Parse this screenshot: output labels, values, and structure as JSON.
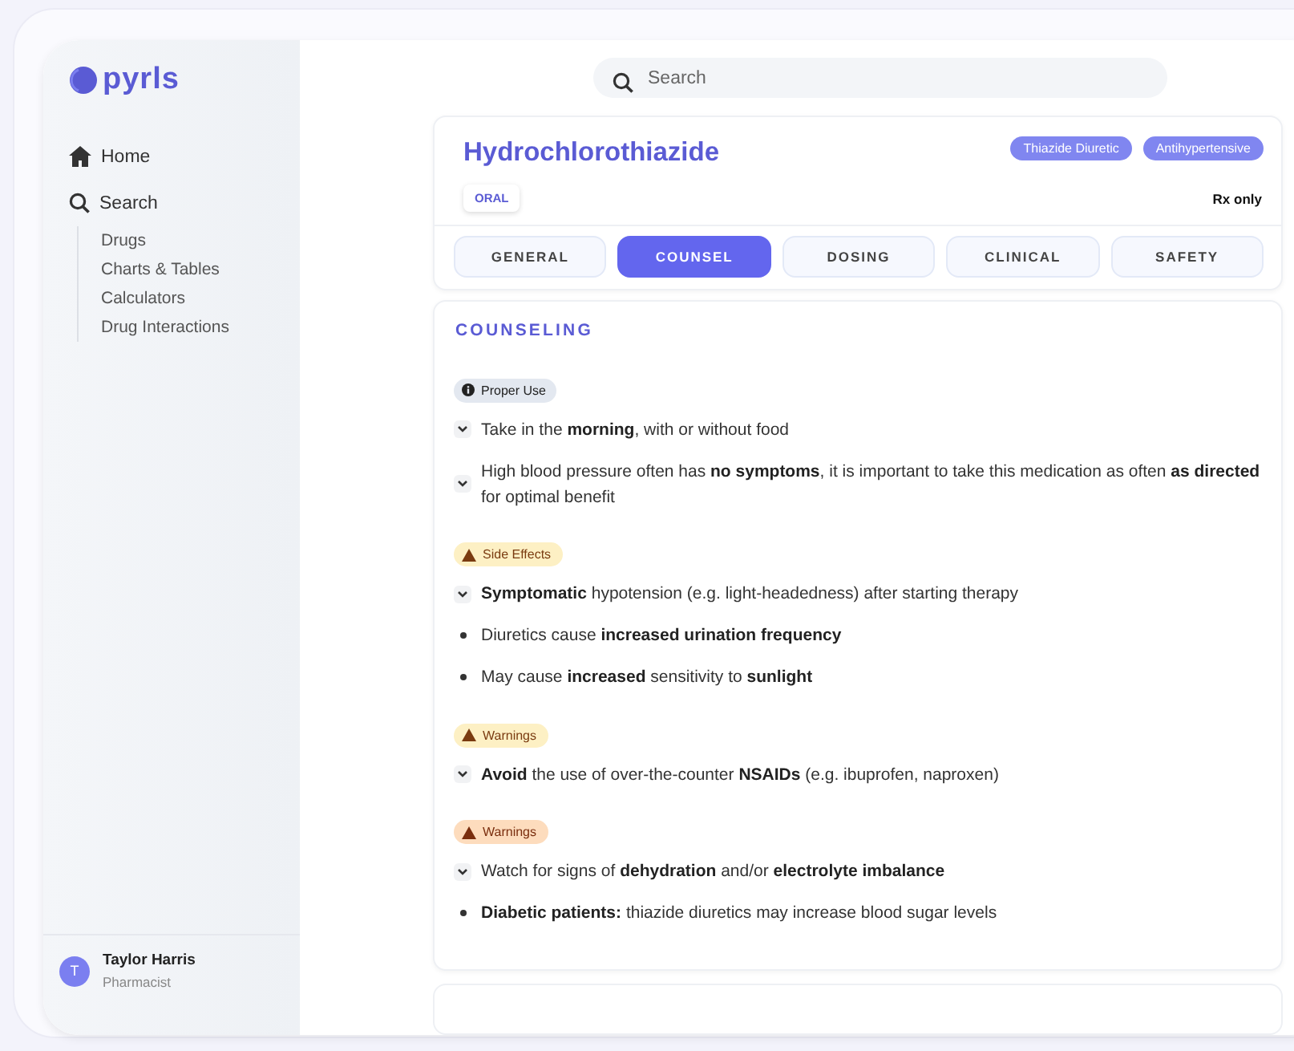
{
  "sidebar": {
    "logo": "pyrls",
    "nav": [
      {
        "label": "Home",
        "kind": "home"
      },
      {
        "label": "Search",
        "kind": "search",
        "children": [
          {
            "label": "Drugs"
          },
          {
            "label": "Charts & Tables"
          },
          {
            "label": "Calculators"
          },
          {
            "label": "Drug Interactions"
          }
        ]
      }
    ],
    "user": {
      "initial": "T",
      "name": "Taylor Harris",
      "role": "Pharmacist"
    }
  },
  "search": {
    "placeholder": "Search"
  },
  "drug": {
    "name": "Hydrochlorothiazide",
    "tags": [
      "Thiazide Diuretic",
      "Antihypertensive"
    ],
    "route": "ORAL",
    "status": "Rx only"
  },
  "tabs": [
    {
      "label": "GENERAL",
      "selected": false
    },
    {
      "label": "COUNSEL",
      "selected": true
    },
    {
      "label": "DOSING",
      "selected": false
    },
    {
      "label": "CLINICAL",
      "selected": false
    },
    {
      "label": "SAFETY",
      "selected": false
    }
  ],
  "section": {
    "title": "COUNSELING",
    "groups": [
      {
        "badge": "Proper Use",
        "kind": "info",
        "items": [
          {
            "kind": "expand",
            "text": "Take in the **morning**, with or without food"
          },
          {
            "kind": "expand",
            "text": "High blood pressure often has **no symptoms**, it is important to take this medication as often **as directed** for optimal benefit"
          }
        ]
      },
      {
        "badge": "Side Effects",
        "kind": "caution",
        "items": [
          {
            "kind": "expand",
            "text": "**Symptomatic** hypotension (e.g. light-headedness) after starting therapy"
          },
          {
            "kind": "bullet",
            "text": "Diuretics cause **increased urination frequency**"
          },
          {
            "kind": "bullet",
            "text": "May cause **increased** sensitivity to **sunlight**"
          }
        ]
      },
      {
        "badge": "Warnings",
        "kind": "caution",
        "items": [
          {
            "kind": "expand",
            "text": "**Avoid** the use of over-the-counter **NSAIDs** (e.g. ibuprofen, naproxen)"
          }
        ]
      },
      {
        "badge": "Warnings",
        "kind": "warning",
        "items": [
          {
            "kind": "expand",
            "text": "Watch for signs of **dehydration** and/or **electrolyte imbalance**"
          },
          {
            "kind": "bullet",
            "text": "**Diabetic patients:** thiazide diuretics may increase blood sugar levels"
          }
        ]
      }
    ]
  }
}
